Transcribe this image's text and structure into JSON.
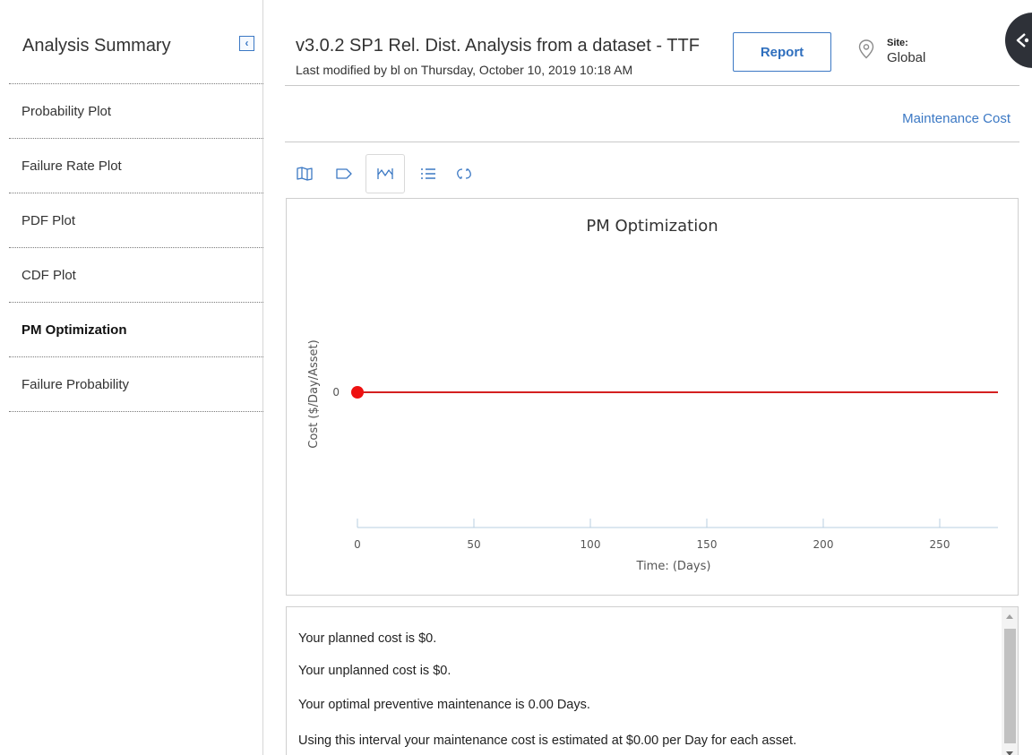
{
  "sidebar": {
    "title": "Analysis Summary",
    "collapse_icon": "chevron-left-icon",
    "items": [
      {
        "label": "Probability Plot",
        "active": false
      },
      {
        "label": "Failure Rate Plot",
        "active": false
      },
      {
        "label": "PDF Plot",
        "active": false
      },
      {
        "label": "CDF Plot",
        "active": false
      },
      {
        "label": "PM Optimization",
        "active": true
      },
      {
        "label": "Failure Probability",
        "active": false
      }
    ]
  },
  "header": {
    "title": "v3.0.2 SP1 Rel. Dist. Analysis from a dataset - TTF",
    "subtitle": "Last modified by bl on Thursday, October 10, 2019 10:18 AM",
    "report_label": "Report",
    "site_label": "Site:",
    "site_value": "Global"
  },
  "maintenance_link": "Maintenance Cost",
  "toolbar": {
    "icons": [
      "map-icon",
      "tag-icon",
      "chart-line-icon",
      "list-icon",
      "reset-icon"
    ],
    "selected": "chart-line-icon"
  },
  "chart_data": {
    "type": "line",
    "title": "PM Optimization",
    "xlabel": "Time: (Days)",
    "ylabel": "Cost ($/Day/Asset)",
    "x_ticks": [
      0,
      50,
      100,
      150,
      200,
      250
    ],
    "y_ticks": [
      0
    ],
    "xlim": [
      0,
      275
    ],
    "series": [
      {
        "x": [
          0,
          275
        ],
        "y": [
          0,
          0
        ],
        "color": "#d42020"
      }
    ],
    "markers": [
      {
        "x": 0,
        "y": 0,
        "color": "#ee1111"
      }
    ]
  },
  "messages": [
    "Your planned cost is $0.",
    "Your unplanned cost is $0.",
    "Your optimal preventive maintenance is 0.00 Days.",
    "Using this interval your maintenance cost is estimated at $0.00 per Day for each asset."
  ],
  "colors": {
    "accent": "#3b78c4",
    "series_line": "#d42020",
    "marker": "#ee1111",
    "axis": "#b8cfe0"
  }
}
